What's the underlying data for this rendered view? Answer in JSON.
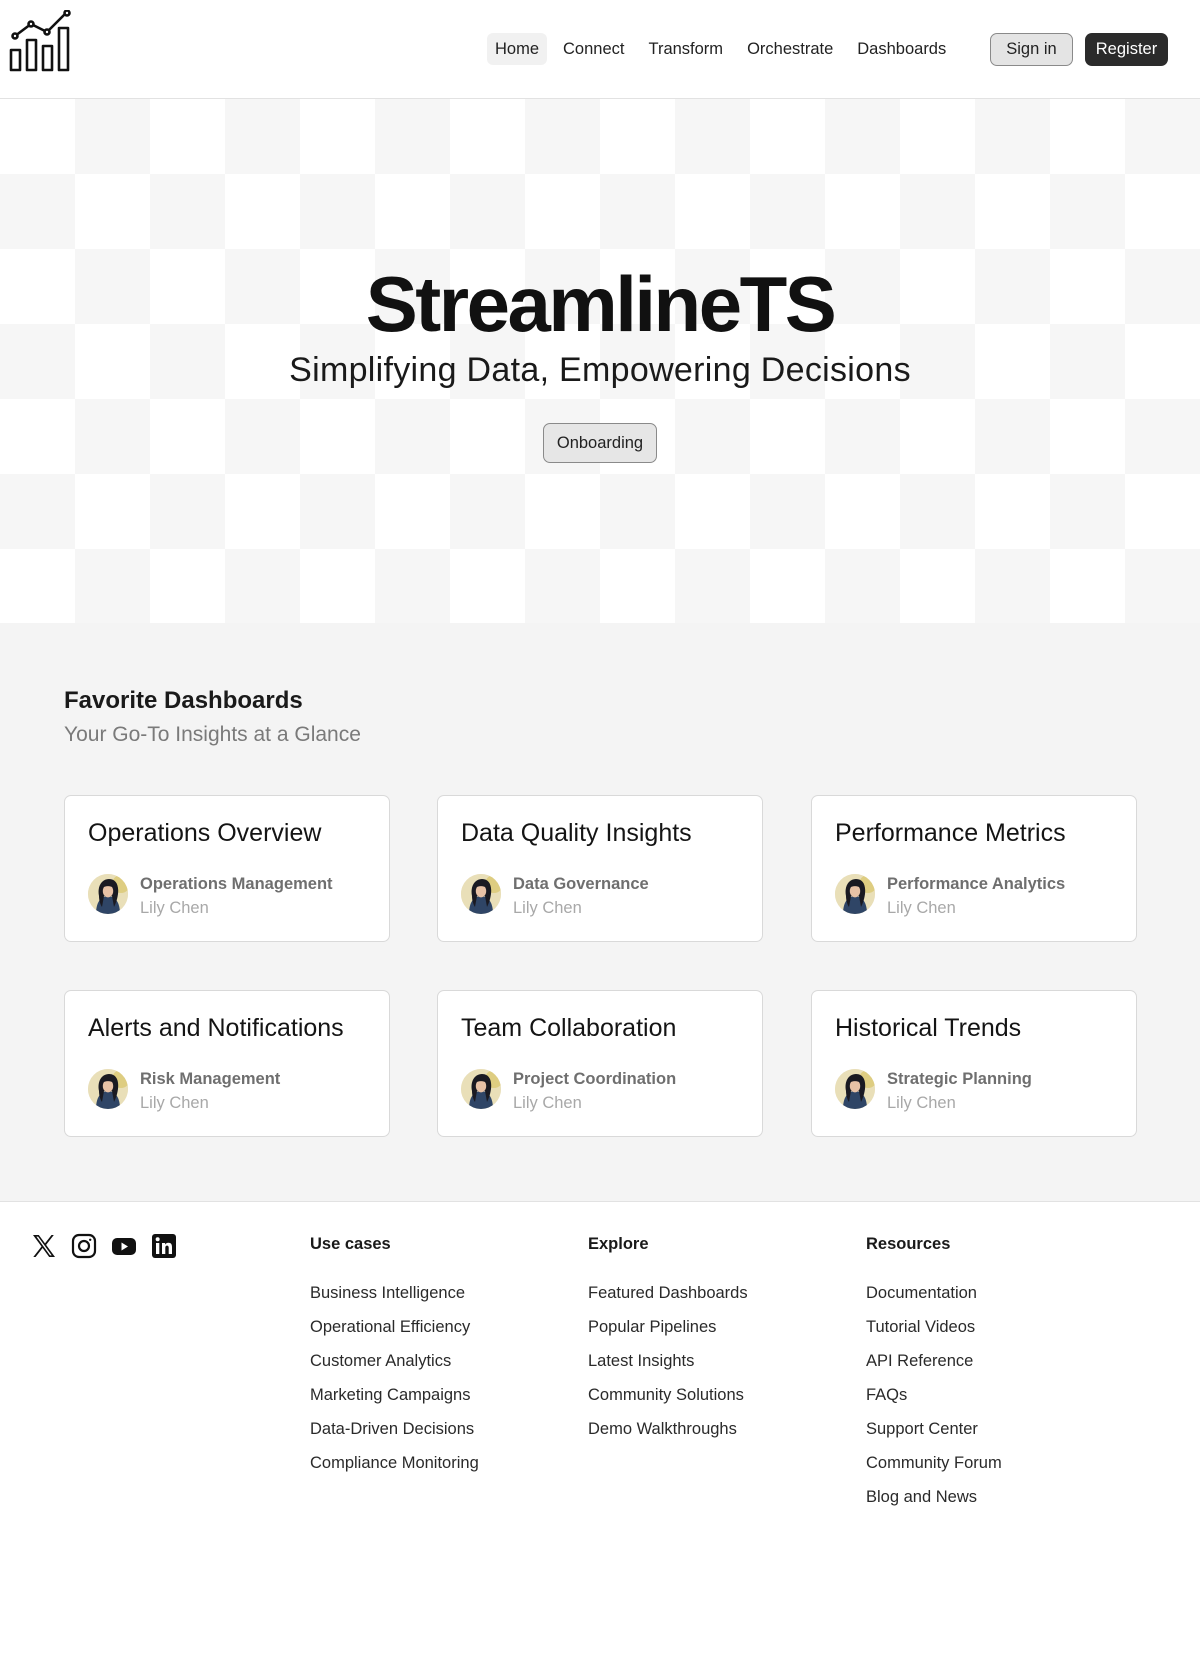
{
  "header": {
    "logo_icon": "bar-chart-trend-icon",
    "nav": [
      {
        "label": "Home",
        "active": true
      },
      {
        "label": "Connect",
        "active": false
      },
      {
        "label": "Transform",
        "active": false
      },
      {
        "label": "Orchestrate",
        "active": false
      },
      {
        "label": "Dashboards",
        "active": false
      }
    ],
    "signin_label": "Sign in",
    "register_label": "Register"
  },
  "hero": {
    "title": "StreamlineTS",
    "subtitle": "Simplifying Data, Empowering Decisions",
    "cta_label": "Onboarding"
  },
  "favorites": {
    "title": "Favorite Dashboards",
    "subtitle": "Your Go-To Insights at a Glance",
    "cards": [
      {
        "title": "Operations Overview",
        "category": "Operations Management",
        "author": "Lily Chen"
      },
      {
        "title": "Data Quality Insights",
        "category": "Data Governance",
        "author": "Lily Chen"
      },
      {
        "title": "Performance Metrics",
        "category": "Performance Analytics",
        "author": "Lily Chen"
      },
      {
        "title": "Alerts and Notifications",
        "category": "Risk Management",
        "author": "Lily Chen"
      },
      {
        "title": "Team Collaboration",
        "category": "Project Coordination",
        "author": "Lily Chen"
      },
      {
        "title": "Historical Trends",
        "category": "Strategic Planning",
        "author": "Lily Chen"
      }
    ]
  },
  "footer": {
    "social": [
      "x-icon",
      "instagram-icon",
      "youtube-icon",
      "linkedin-icon"
    ],
    "columns": [
      {
        "heading": "Use cases",
        "links": [
          "Business Intelligence",
          "Operational Efficiency",
          "Customer Analytics",
          "Marketing Campaigns",
          "Data-Driven Decisions",
          "Compliance Monitoring"
        ]
      },
      {
        "heading": "Explore",
        "links": [
          "Featured Dashboards",
          "Popular Pipelines",
          "Latest Insights",
          "Community Solutions",
          "Demo Walkthroughs"
        ]
      },
      {
        "heading": "Resources",
        "links": [
          "Documentation",
          "Tutorial Videos",
          "API Reference",
          "FAQs",
          "Support Center",
          "Community Forum",
          "Blog and News"
        ]
      }
    ]
  },
  "colors": {
    "accent": "#2b2b2b",
    "section_bg": "#f4f4f4",
    "muted": "#7a7a7a"
  }
}
